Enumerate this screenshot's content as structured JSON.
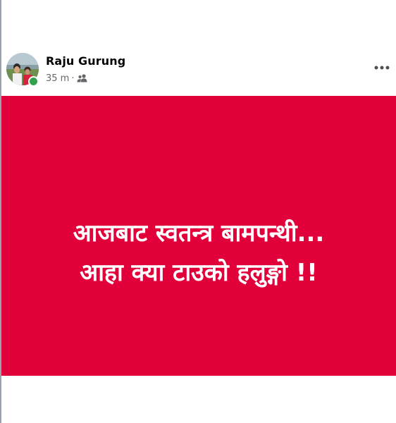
{
  "post": {
    "author_name": "Raju Gurung",
    "time_ago": "35 m",
    "separator": "·",
    "audience_icon": "friends-icon",
    "more_icon": "more-options-icon",
    "online_status": "online"
  },
  "image": {
    "background": "#e2003b",
    "text_color": "#ffffff",
    "line1": "आजबाट स्वतन्त्र बामपन्थी...",
    "line2": "आहा क्या टाउको हलुङ्गो !!"
  }
}
